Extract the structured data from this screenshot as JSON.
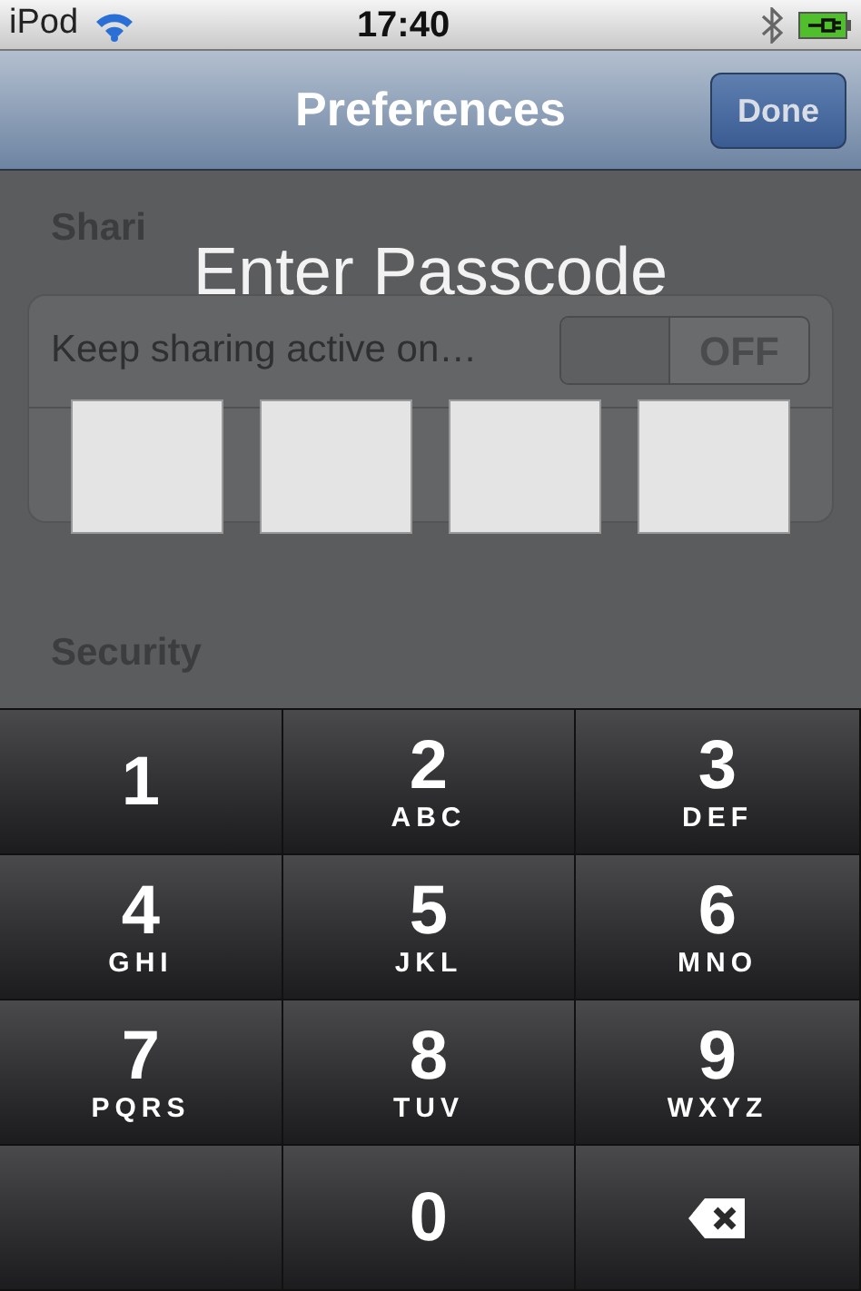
{
  "status_bar": {
    "carrier": "iPod",
    "time": "17:40"
  },
  "nav_bar": {
    "title": "Preferences",
    "done_button": "Done"
  },
  "background": {
    "section_header": "Shari",
    "row_label": "Keep sharing active on…",
    "toggle": {
      "label": "OFF",
      "on": false
    },
    "second_section_header": "Security"
  },
  "passcode": {
    "title": "Enter Passcode",
    "boxes": [
      {
        "filled": false
      },
      {
        "filled": false
      },
      {
        "filled": false
      },
      {
        "filled": false
      }
    ]
  },
  "keypad": [
    {
      "kind": "digit",
      "digit": "1"
    },
    {
      "kind": "digit",
      "digit": "2",
      "letters": "ABC"
    },
    {
      "kind": "digit",
      "digit": "3",
      "letters": "DEF"
    },
    {
      "kind": "digit",
      "digit": "4",
      "letters": "GHI"
    },
    {
      "kind": "digit",
      "digit": "5",
      "letters": "JKL"
    },
    {
      "kind": "digit",
      "digit": "6",
      "letters": "MNO"
    },
    {
      "kind": "digit",
      "digit": "7",
      "letters": "PQRS"
    },
    {
      "kind": "digit",
      "digit": "8",
      "letters": "TUV"
    },
    {
      "kind": "digit",
      "digit": "9",
      "letters": "WXYZ"
    },
    {
      "kind": "blank"
    },
    {
      "kind": "digit",
      "digit": "0"
    },
    {
      "kind": "delete"
    }
  ]
}
